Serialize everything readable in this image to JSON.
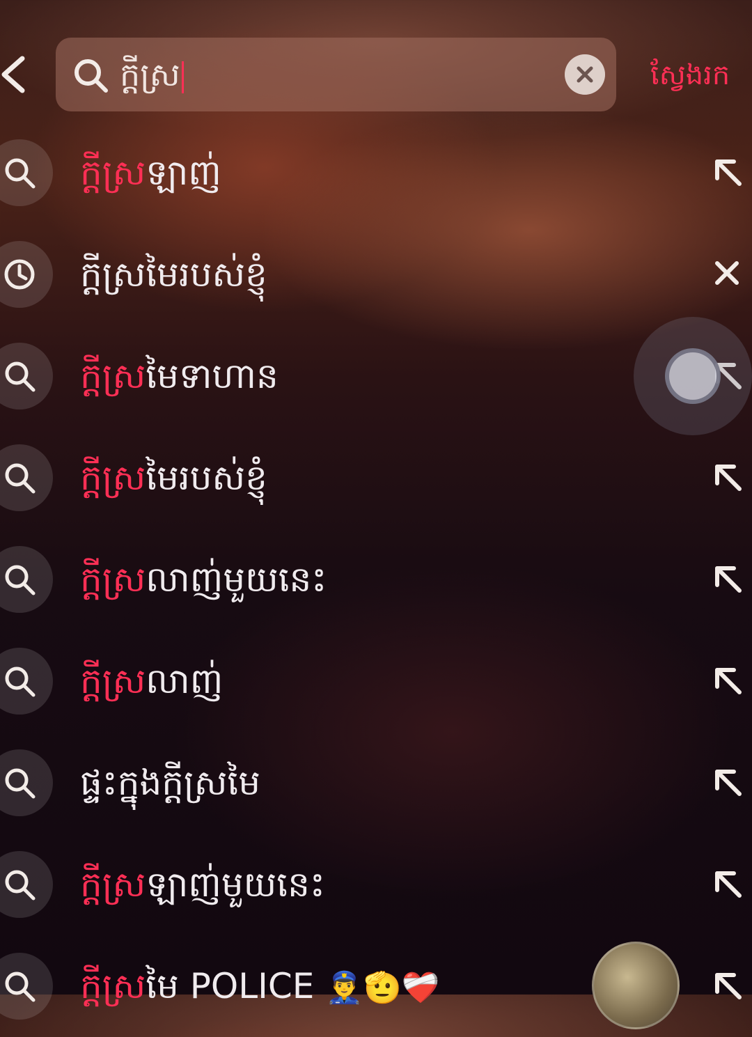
{
  "header": {
    "query": "ក្តីស្រ",
    "search_button": "ស្វែងរក"
  },
  "suggestions": [
    {
      "highlight": "ក្តីស្រ",
      "rest": "ឡាញ់",
      "icon": "search-icon",
      "action": "fill-arrow-icon"
    },
    {
      "highlight": "",
      "rest": "ក្តីស្រមៃរបស់ខ្ញុំ",
      "icon": "history-clock-icon",
      "action": "remove-icon"
    },
    {
      "highlight": "ក្តីស្រ",
      "rest": "មៃទាហាន",
      "icon": "search-icon",
      "action": "fill-arrow-icon"
    },
    {
      "highlight": "ក្តីស្រ",
      "rest": "មៃរបស់ខ្ញុំ",
      "icon": "search-icon",
      "action": "fill-arrow-icon"
    },
    {
      "highlight": "ក្តីស្រ",
      "rest": "លាញ់មួយនេះ",
      "icon": "search-icon",
      "action": "fill-arrow-icon"
    },
    {
      "highlight": "ក្តីស្រ",
      "rest": "លាញ់",
      "icon": "search-icon",
      "action": "fill-arrow-icon"
    },
    {
      "highlight": "",
      "rest": "ផ្ទះក្នុងក្តីស្រមៃ",
      "icon": "search-icon",
      "action": "fill-arrow-icon"
    },
    {
      "highlight": "ក្តីស្រ",
      "rest": "ឡាញ់មួយនេះ",
      "icon": "search-icon",
      "action": "fill-arrow-icon"
    },
    {
      "highlight": "ក្តីស្រ",
      "rest": "មៃ POLICE",
      "emoji": "👮‍♂️🫡❤️‍🩹",
      "icon": "search-icon",
      "action": "fill-arrow-icon"
    }
  ],
  "colors": {
    "accent": "#ff2f55",
    "text": "#f0ebee"
  }
}
